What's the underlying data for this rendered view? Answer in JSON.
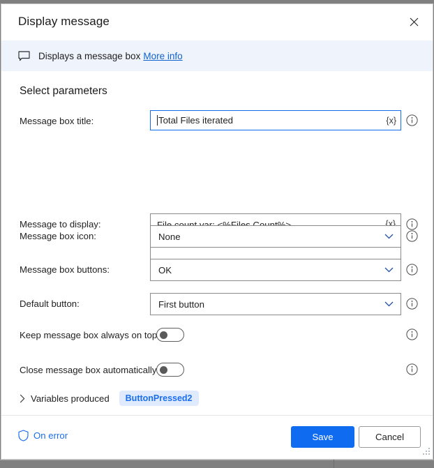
{
  "dialog": {
    "title": "Display message",
    "close_icon": "close-icon"
  },
  "banner": {
    "icon": "message-bubble-icon",
    "text": "Displays a message box",
    "link": "More info"
  },
  "section": {
    "title": "Select parameters"
  },
  "fields": {
    "message_box_title": {
      "label": "Message box title:",
      "value": "Total Files iterated",
      "var_picker": "{x}",
      "info_icon": "info-circle-icon"
    },
    "message_to_display": {
      "label": "Message to display:",
      "value": "File count var: <%Files.Count%>\nFor Each count var <%FileCount%>",
      "var_picker": "{x}",
      "info_icon": "info-circle-icon"
    },
    "message_box_icon": {
      "label": "Message box icon:",
      "value": "None",
      "info_icon": "info-circle-icon"
    },
    "message_box_buttons": {
      "label": "Message box buttons:",
      "value": "OK",
      "info_icon": "info-circle-icon"
    },
    "default_button": {
      "label": "Default button:",
      "value": "First button",
      "info_icon": "info-circle-icon"
    },
    "keep_on_top": {
      "label": "Keep message box always on top:",
      "state": "off",
      "info_icon": "info-circle-icon"
    },
    "close_automatically": {
      "label": "Close message box automatically:",
      "state": "off",
      "info_icon": "info-circle-icon"
    }
  },
  "variables_produced": {
    "chevron": "chevron-right-icon",
    "label": "Variables produced",
    "badge": "ButtonPressed2"
  },
  "footer": {
    "on_error_label": "On error",
    "on_error_icon": "shield-icon",
    "save_label": "Save",
    "cancel_label": "Cancel"
  },
  "colors": {
    "accent": "#0f6cf0",
    "link": "#1a6ef0",
    "banner_bg": "#eff4fc",
    "badge_bg": "#dfeafc",
    "border": "#8a8a8a"
  }
}
